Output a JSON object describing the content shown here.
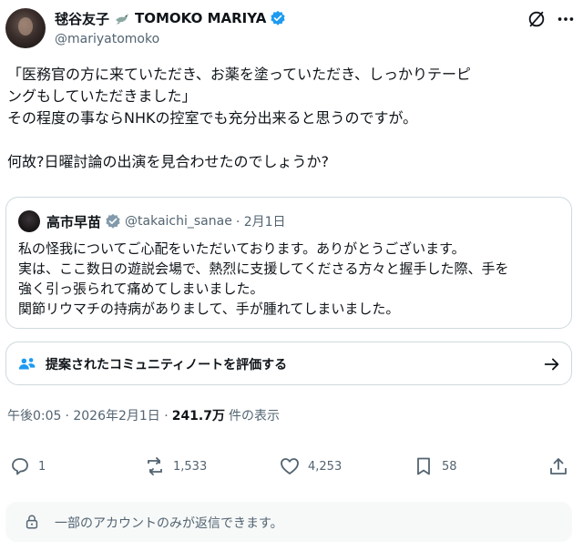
{
  "author": {
    "name": "毬谷友子",
    "name_latin": "TOMOKO MARIYA",
    "handle": "@mariyatomoko"
  },
  "tweet": {
    "lines": [
      "「医務官の方に来ていただき、お薬を塗っていただき、しっかりテーピ",
      "ングもしていただきました」",
      "その程度の事ならNHKの控室でも充分出来ると思うのですが。",
      "何故?日曜討論の出演を見合わせたのでしょうか?"
    ]
  },
  "quote": {
    "name": "高市早苗",
    "handle": "@takaichi_sanae",
    "date": "· 2月1日",
    "lines": [
      "私の怪我についてご心配をいただいております。ありがとうございます。",
      "実は、ここ数日の遊説会場で、熱烈に支援してくださる方々と握手した際、手を",
      "強く引っ張られて痛めてしまいました。",
      "関節リウマチの持病がありまして、手が腫れてしまいました。"
    ]
  },
  "community_note": {
    "label": "提案されたコミュニティノートを評価する"
  },
  "meta": {
    "time": "午後0:05",
    "date": "· 2026年2月1日 ·",
    "views": "241.7万",
    "views_label": "件の表示"
  },
  "actions": {
    "replies": "1",
    "reposts": "1,533",
    "likes": "4,253",
    "bookmarks": "58"
  },
  "reply_restriction": {
    "text": "一部のアカウントのみが返信できます。"
  },
  "colors": {
    "verified": "#1d9bf0",
    "secondary_text": "#536471",
    "border": "#cfd9de",
    "community_icon": "#1d9bf0"
  },
  "icons": {
    "dove": "dove-icon",
    "verified": "verified-badge-icon",
    "grok": "grok-icon",
    "more": "more-icon",
    "community": "people-icon",
    "arrow": "arrow-right-icon",
    "reply": "reply-icon",
    "repost": "repost-icon",
    "like": "heart-icon",
    "bookmark": "bookmark-icon",
    "share": "share-icon",
    "lock": "lock-icon"
  }
}
